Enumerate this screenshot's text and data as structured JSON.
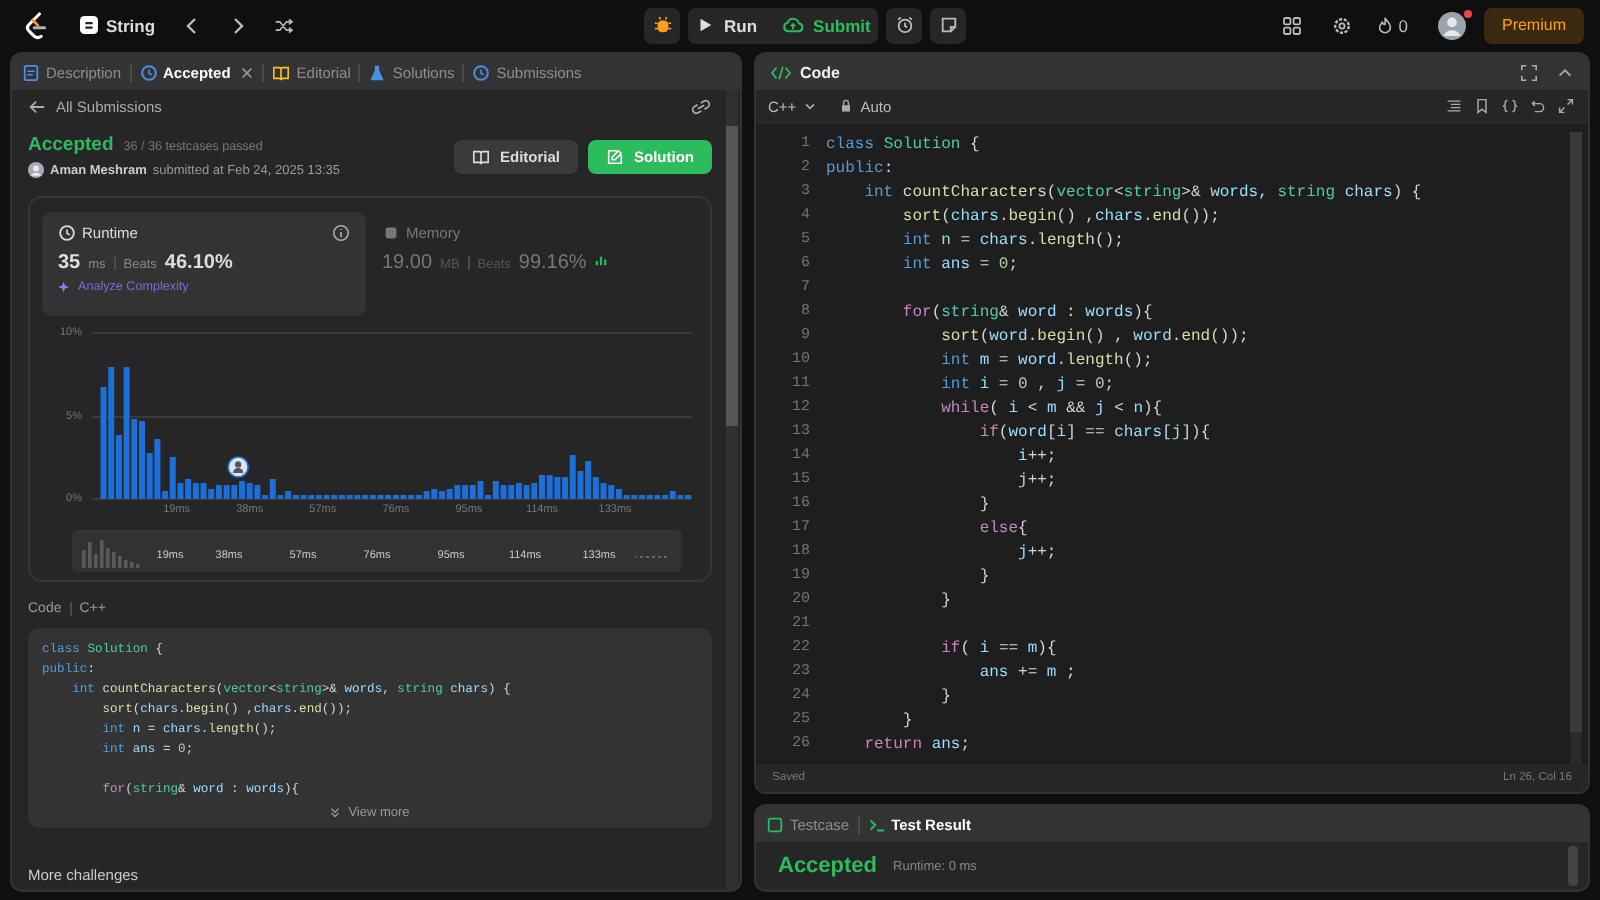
{
  "topbar": {
    "problem_list": "String",
    "run": "Run",
    "submit": "Submit",
    "streak": "0",
    "notification": true,
    "premium": "Premium"
  },
  "left_panel": {
    "tabs": [
      {
        "label": "Description",
        "kind": "description",
        "selected": false,
        "closable": false
      },
      {
        "label": "Accepted",
        "kind": "result",
        "selected": true,
        "closable": true
      },
      {
        "label": "Editorial",
        "kind": "editorial",
        "selected": false,
        "closable": false
      },
      {
        "label": "Solutions",
        "kind": "solutions",
        "selected": false,
        "closable": false
      },
      {
        "label": "Submissions",
        "kind": "submissions",
        "selected": false,
        "closable": false
      }
    ],
    "back_link": "All Submissions",
    "submission": {
      "status": "Accepted",
      "testcases": "36 / 36 testcases passed",
      "user": "Aman Meshram",
      "submitted": "submitted at Feb 24, 2025 13:35",
      "editorial_button": "Editorial",
      "solution_button": "Solution"
    },
    "metrics": [
      {
        "kind": "runtime",
        "title": "Runtime",
        "value": "35",
        "unit": "ms",
        "beats_label": "Beats",
        "beats": "46.10%",
        "selected": true,
        "link": "Analyze Complexity"
      },
      {
        "kind": "memory",
        "title": "Memory",
        "value": "19.00",
        "unit": "MB",
        "beats_label": "Beats",
        "beats": "99.16%",
        "selected": false
      }
    ],
    "chart_data": {
      "type": "bar",
      "xlim": [
        -3,
        153
      ],
      "ylim": [
        0,
        10
      ],
      "x": [
        0,
        2,
        4,
        6,
        8,
        10,
        12,
        14,
        16,
        18,
        20,
        22,
        24,
        26,
        28,
        30,
        32,
        34,
        36,
        38,
        40,
        42,
        44,
        46,
        48,
        50,
        52,
        54,
        56,
        58,
        60,
        62,
        64,
        66,
        68,
        70,
        72,
        74,
        76,
        78,
        80,
        82,
        84,
        86,
        88,
        90,
        92,
        94,
        96,
        98,
        100,
        102,
        104,
        106,
        108,
        110,
        112,
        114,
        116,
        118,
        120,
        122,
        124,
        126,
        128,
        130,
        132,
        134,
        136,
        138,
        140,
        142,
        144,
        146,
        148,
        150,
        152
      ],
      "values": [
        6.8,
        8.0,
        3.8,
        8.0,
        4.8,
        4.7,
        2.8,
        3.6,
        0.5,
        2.5,
        1.0,
        1.2,
        1.0,
        1.0,
        0.6,
        0.8,
        0.8,
        0.8,
        1.1,
        1.0,
        0.8,
        0.3,
        1.2,
        0.3,
        0.5,
        0.3,
        0.3,
        0.3,
        0.3,
        0.3,
        0.3,
        0.3,
        0.3,
        0.3,
        0.3,
        0.3,
        0.3,
        0.3,
        0.3,
        0.3,
        0.3,
        0.3,
        0.5,
        0.6,
        0.5,
        0.6,
        0.8,
        0.9,
        0.9,
        1.1,
        0.3,
        1.1,
        0.8,
        0.8,
        1.0,
        0.8,
        1.0,
        1.5,
        1.5,
        1.3,
        1.3,
        2.6,
        1.7,
        2.3,
        1.3,
        1.0,
        0.9,
        0.6,
        0.3,
        0.3,
        0.3,
        0.3,
        0.3,
        0.3,
        0.5,
        0.3,
        0.3
      ],
      "xticks": [
        {
          "value": 19,
          "label": "19ms"
        },
        {
          "value": 38,
          "label": "38ms"
        },
        {
          "value": 57,
          "label": "57ms"
        },
        {
          "value": 76,
          "label": "76ms"
        },
        {
          "value": 95,
          "label": "95ms"
        },
        {
          "value": 114,
          "label": "114ms"
        },
        {
          "value": 133,
          "label": "133ms"
        }
      ],
      "yticks": [
        {
          "value": 0,
          "label": "0%"
        },
        {
          "value": 5,
          "label": "5%"
        },
        {
          "value": 10,
          "label": "10%"
        }
      ]
    },
    "navigator_labels": [
      "19ms",
      "38ms",
      "57ms",
      "76ms",
      "95ms",
      "114ms",
      "133ms"
    ],
    "code_header": {
      "title": "Code",
      "language": "C++"
    },
    "code_preview": [
      {
        "kind": "code",
        "tokens": [
          {
            "text": "class ",
            "kind": "keyword"
          },
          {
            "text": "Solution",
            "kind": "type"
          },
          {
            "text": " {",
            "kind": "plain"
          }
        ]
      },
      {
        "kind": "code",
        "tokens": [
          {
            "text": "public",
            "kind": "keyword"
          },
          {
            "text": ":",
            "kind": "plain"
          }
        ]
      },
      {
        "kind": "code",
        "tokens": [
          {
            "text": "    int ",
            "kind": "keyword"
          },
          {
            "text": "countCharacters",
            "kind": "function"
          },
          {
            "text": "(",
            "kind": "plain"
          },
          {
            "text": "vector",
            "kind": "type"
          },
          {
            "text": "<",
            "kind": "plain"
          },
          {
            "text": "string",
            "kind": "type"
          },
          {
            "text": ">& ",
            "kind": "plain"
          },
          {
            "text": "words",
            "kind": "variable"
          },
          {
            "text": ", ",
            "kind": "plain"
          },
          {
            "text": "string ",
            "kind": "type"
          },
          {
            "text": "chars",
            "kind": "variable"
          },
          {
            "text": ") {",
            "kind": "plain"
          }
        ]
      },
      {
        "kind": "code",
        "tokens": [
          {
            "text": "        sort",
            "kind": "function"
          },
          {
            "text": "(",
            "kind": "plain"
          },
          {
            "text": "chars",
            "kind": "variable"
          },
          {
            "text": ".",
            "kind": "plain"
          },
          {
            "text": "begin",
            "kind": "function"
          },
          {
            "text": "() ,",
            "kind": "plain"
          },
          {
            "text": "chars",
            "kind": "variable"
          },
          {
            "text": ".",
            "kind": "plain"
          },
          {
            "text": "end",
            "kind": "function"
          },
          {
            "text": "());",
            "kind": "plain"
          }
        ]
      },
      {
        "kind": "code",
        "tokens": [
          {
            "text": "        int ",
            "kind": "keyword"
          },
          {
            "text": "n",
            "kind": "variable"
          },
          {
            "text": " = ",
            "kind": "plain"
          },
          {
            "text": "chars",
            "kind": "variable"
          },
          {
            "text": ".",
            "kind": "plain"
          },
          {
            "text": "length",
            "kind": "function"
          },
          {
            "text": "();",
            "kind": "plain"
          }
        ]
      },
      {
        "kind": "code",
        "tokens": [
          {
            "text": "        int ",
            "kind": "keyword"
          },
          {
            "text": "ans",
            "kind": "variable"
          },
          {
            "text": " = ",
            "kind": "plain"
          },
          {
            "text": "0",
            "kind": "number"
          },
          {
            "text": ";",
            "kind": "plain"
          }
        ]
      },
      {
        "kind": "blank"
      },
      {
        "kind": "code",
        "tokens": [
          {
            "text": "        for",
            "kind": "control"
          },
          {
            "text": "(",
            "kind": "plain"
          },
          {
            "text": "string",
            "kind": "type"
          },
          {
            "text": "& ",
            "kind": "plain"
          },
          {
            "text": "word",
            "kind": "variable"
          },
          {
            "text": " : ",
            "kind": "plain"
          },
          {
            "text": "words",
            "kind": "variable"
          },
          {
            "text": "){",
            "kind": "plain"
          }
        ]
      }
    ],
    "view_more": "View more",
    "more": "More challenges"
  },
  "editor": {
    "title": "Code",
    "language": "C++",
    "mode": "Auto",
    "lines": [
      {
        "n": "1",
        "tokens": [
          {
            "text": "class ",
            "kind": "keyword"
          },
          {
            "text": "Solution",
            "kind": "type"
          },
          {
            "text": " {",
            "kind": "plain"
          }
        ]
      },
      {
        "n": "2",
        "tokens": [
          {
            "text": "public",
            "kind": "keyword"
          },
          {
            "text": ":",
            "kind": "plain"
          }
        ]
      },
      {
        "n": "3",
        "tokens": [
          {
            "text": "    int ",
            "kind": "keyword"
          },
          {
            "text": "countCharacters",
            "kind": "function"
          },
          {
            "text": "(",
            "kind": "plain"
          },
          {
            "text": "vector",
            "kind": "type"
          },
          {
            "text": "<",
            "kind": "plain"
          },
          {
            "text": "string",
            "kind": "type"
          },
          {
            "text": ">& ",
            "kind": "plain"
          },
          {
            "text": "words",
            "kind": "variable"
          },
          {
            "text": ", ",
            "kind": "plain"
          },
          {
            "text": "string ",
            "kind": "type"
          },
          {
            "text": "chars",
            "kind": "variable"
          },
          {
            "text": ") {",
            "kind": "plain"
          }
        ]
      },
      {
        "n": "4",
        "tokens": [
          {
            "text": "        sort",
            "kind": "function"
          },
          {
            "text": "(",
            "kind": "plain"
          },
          {
            "text": "chars",
            "kind": "variable"
          },
          {
            "text": ".",
            "kind": "plain"
          },
          {
            "text": "begin",
            "kind": "function"
          },
          {
            "text": "() ,",
            "kind": "plain"
          },
          {
            "text": "chars",
            "kind": "variable"
          },
          {
            "text": ".",
            "kind": "plain"
          },
          {
            "text": "end",
            "kind": "function"
          },
          {
            "text": "());",
            "kind": "plain"
          }
        ]
      },
      {
        "n": "5",
        "tokens": [
          {
            "text": "        int ",
            "kind": "keyword"
          },
          {
            "text": "n",
            "kind": "variable"
          },
          {
            "text": " = ",
            "kind": "plain"
          },
          {
            "text": "chars",
            "kind": "variable"
          },
          {
            "text": ".",
            "kind": "plain"
          },
          {
            "text": "length",
            "kind": "function"
          },
          {
            "text": "();",
            "kind": "plain"
          }
        ]
      },
      {
        "n": "6",
        "tokens": [
          {
            "text": "        int ",
            "kind": "keyword"
          },
          {
            "text": "ans",
            "kind": "variable"
          },
          {
            "text": " = ",
            "kind": "plain"
          },
          {
            "text": "0",
            "kind": "number"
          },
          {
            "text": ";",
            "kind": "plain"
          }
        ]
      },
      {
        "n": "7"
      },
      {
        "n": "8",
        "tokens": [
          {
            "text": "        for",
            "kind": "control"
          },
          {
            "text": "(",
            "kind": "plain"
          },
          {
            "text": "string",
            "kind": "type"
          },
          {
            "text": "& ",
            "kind": "plain"
          },
          {
            "text": "word",
            "kind": "variable"
          },
          {
            "text": " : ",
            "kind": "plain"
          },
          {
            "text": "words",
            "kind": "variable"
          },
          {
            "text": "){",
            "kind": "plain"
          }
        ]
      },
      {
        "n": "9",
        "tokens": [
          {
            "text": "            sort",
            "kind": "function"
          },
          {
            "text": "(",
            "kind": "plain"
          },
          {
            "text": "word",
            "kind": "variable"
          },
          {
            "text": ".",
            "kind": "plain"
          },
          {
            "text": "begin",
            "kind": "function"
          },
          {
            "text": "() , ",
            "kind": "plain"
          },
          {
            "text": "word",
            "kind": "variable"
          },
          {
            "text": ".",
            "kind": "plain"
          },
          {
            "text": "end",
            "kind": "function"
          },
          {
            "text": "());",
            "kind": "plain"
          }
        ]
      },
      {
        "n": "10",
        "tokens": [
          {
            "text": "            int ",
            "kind": "keyword"
          },
          {
            "text": "m",
            "kind": "variable"
          },
          {
            "text": " = ",
            "kind": "plain"
          },
          {
            "text": "word",
            "kind": "variable"
          },
          {
            "text": ".",
            "kind": "plain"
          },
          {
            "text": "length",
            "kind": "function"
          },
          {
            "text": "();",
            "kind": "plain"
          }
        ]
      },
      {
        "n": "11",
        "tokens": [
          {
            "text": "            int ",
            "kind": "keyword"
          },
          {
            "text": "i",
            "kind": "variable"
          },
          {
            "text": " = ",
            "kind": "plain"
          },
          {
            "text": "0",
            "kind": "number"
          },
          {
            "text": " , ",
            "kind": "plain"
          },
          {
            "text": "j",
            "kind": "variable"
          },
          {
            "text": " = ",
            "kind": "plain"
          },
          {
            "text": "0",
            "kind": "number"
          },
          {
            "text": ";",
            "kind": "plain"
          }
        ]
      },
      {
        "n": "12",
        "tokens": [
          {
            "text": "            while",
            "kind": "control"
          },
          {
            "text": "( ",
            "kind": "plain"
          },
          {
            "text": "i",
            "kind": "variable"
          },
          {
            "text": " < ",
            "kind": "plain"
          },
          {
            "text": "m",
            "kind": "variable"
          },
          {
            "text": " && ",
            "kind": "plain"
          },
          {
            "text": "j",
            "kind": "variable"
          },
          {
            "text": " < ",
            "kind": "plain"
          },
          {
            "text": "n",
            "kind": "variable"
          },
          {
            "text": "){",
            "kind": "plain"
          }
        ]
      },
      {
        "n": "13",
        "tokens": [
          {
            "text": "                if",
            "kind": "control"
          },
          {
            "text": "(",
            "kind": "plain"
          },
          {
            "text": "word",
            "kind": "variable"
          },
          {
            "text": "[",
            "kind": "plain"
          },
          {
            "text": "i",
            "kind": "variable"
          },
          {
            "text": "] == ",
            "kind": "plain"
          },
          {
            "text": "chars",
            "kind": "variable"
          },
          {
            "text": "[",
            "kind": "plain"
          },
          {
            "text": "j",
            "kind": "variable"
          },
          {
            "text": "]){",
            "kind": "plain"
          }
        ]
      },
      {
        "n": "14",
        "tokens": [
          {
            "text": "                    i",
            "kind": "variable"
          },
          {
            "text": "++;",
            "kind": "plain"
          }
        ]
      },
      {
        "n": "15",
        "tokens": [
          {
            "text": "                    j",
            "kind": "variable"
          },
          {
            "text": "++;",
            "kind": "plain"
          }
        ]
      },
      {
        "n": "16",
        "tokens": [
          {
            "text": "                }",
            "kind": "plain"
          }
        ]
      },
      {
        "n": "17",
        "tokens": [
          {
            "text": "                else",
            "kind": "control"
          },
          {
            "text": "{",
            "kind": "plain"
          }
        ]
      },
      {
        "n": "18",
        "tokens": [
          {
            "text": "                    j",
            "kind": "variable"
          },
          {
            "text": "++;",
            "kind": "plain"
          }
        ]
      },
      {
        "n": "19",
        "tokens": [
          {
            "text": "                }",
            "kind": "plain"
          }
        ]
      },
      {
        "n": "20",
        "tokens": [
          {
            "text": "            }",
            "kind": "plain"
          }
        ]
      },
      {
        "n": "21"
      },
      {
        "n": "22",
        "tokens": [
          {
            "text": "            if",
            "kind": "control"
          },
          {
            "text": "( ",
            "kind": "plain"
          },
          {
            "text": "i",
            "kind": "variable"
          },
          {
            "text": " == ",
            "kind": "plain"
          },
          {
            "text": "m",
            "kind": "variable"
          },
          {
            "text": "){",
            "kind": "plain"
          }
        ]
      },
      {
        "n": "23",
        "tokens": [
          {
            "text": "                ans",
            "kind": "variable"
          },
          {
            "text": " += ",
            "kind": "plain"
          },
          {
            "text": "m",
            "kind": "variable"
          },
          {
            "text": " ;",
            "kind": "plain"
          }
        ]
      },
      {
        "n": "24",
        "tokens": [
          {
            "text": "            }",
            "kind": "plain"
          }
        ]
      },
      {
        "n": "25",
        "tokens": [
          {
            "text": "        }",
            "kind": "plain"
          }
        ]
      },
      {
        "n": "26",
        "tokens": [
          {
            "text": "    return ",
            "kind": "control"
          },
          {
            "text": "ans",
            "kind": "variable"
          },
          {
            "text": ";",
            "kind": "plain"
          }
        ]
      }
    ],
    "status": "Saved",
    "cursor": "Ln 26, Col 16"
  },
  "test_panel": {
    "tabs": [
      {
        "label": "Testcase",
        "kind": "testcase",
        "selected": false
      },
      {
        "label": "Test Result",
        "kind": "result",
        "selected": true
      }
    ],
    "result": "Accepted",
    "runtime": "Runtime: 0 ms"
  }
}
